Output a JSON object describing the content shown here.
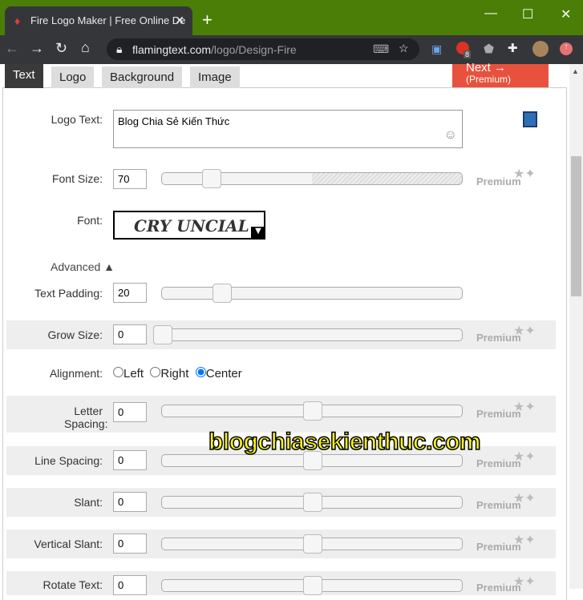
{
  "browser": {
    "tab_title": "Fire Logo Maker | Free Online De",
    "url_domain": "flamingtext.com",
    "url_path": "/logo/Design-Fire",
    "extension_badge": "8"
  },
  "tabs": [
    {
      "label": "Text",
      "active": true
    },
    {
      "label": "Logo"
    },
    {
      "label": "Background"
    },
    {
      "label": "Image"
    }
  ],
  "next_button": {
    "label": "Next →",
    "sublabel": "(Premium)",
    "color": "#e8513e"
  },
  "form": {
    "logo_text_label": "Logo Text:",
    "logo_text_value": "Blog Chia Sẻ Kiến Thức",
    "font_size_label": "Font Size:",
    "font_size_value": "70",
    "font_size_slider": 0.17,
    "font_label": "Font:",
    "font_value": "CRY UNCIAL",
    "advanced_label": "Advanced ▲",
    "premium_label": "Premium",
    "text_padding_label": "Text Padding:",
    "text_padding_value": "20",
    "grow_size_label": "Grow Size:",
    "grow_size_value": "0",
    "alignment_label": "Alignment:",
    "align_left": "Left",
    "align_right": "Right",
    "align_center": "Center",
    "alignment_selected": "Center",
    "letter_spacing_label": "Letter Spacing:",
    "letter_spacing_value": "0",
    "line_spacing_label": "Line Spacing:",
    "line_spacing_value": "0",
    "slant_label": "Slant:",
    "slant_value": "0",
    "vertical_slant_label": "Vertical Slant:",
    "vertical_slant_value": "0",
    "rotate_text_label": "Rotate Text:",
    "rotate_text_value": "0"
  },
  "watermark": "blogchiasekienthuc.com"
}
